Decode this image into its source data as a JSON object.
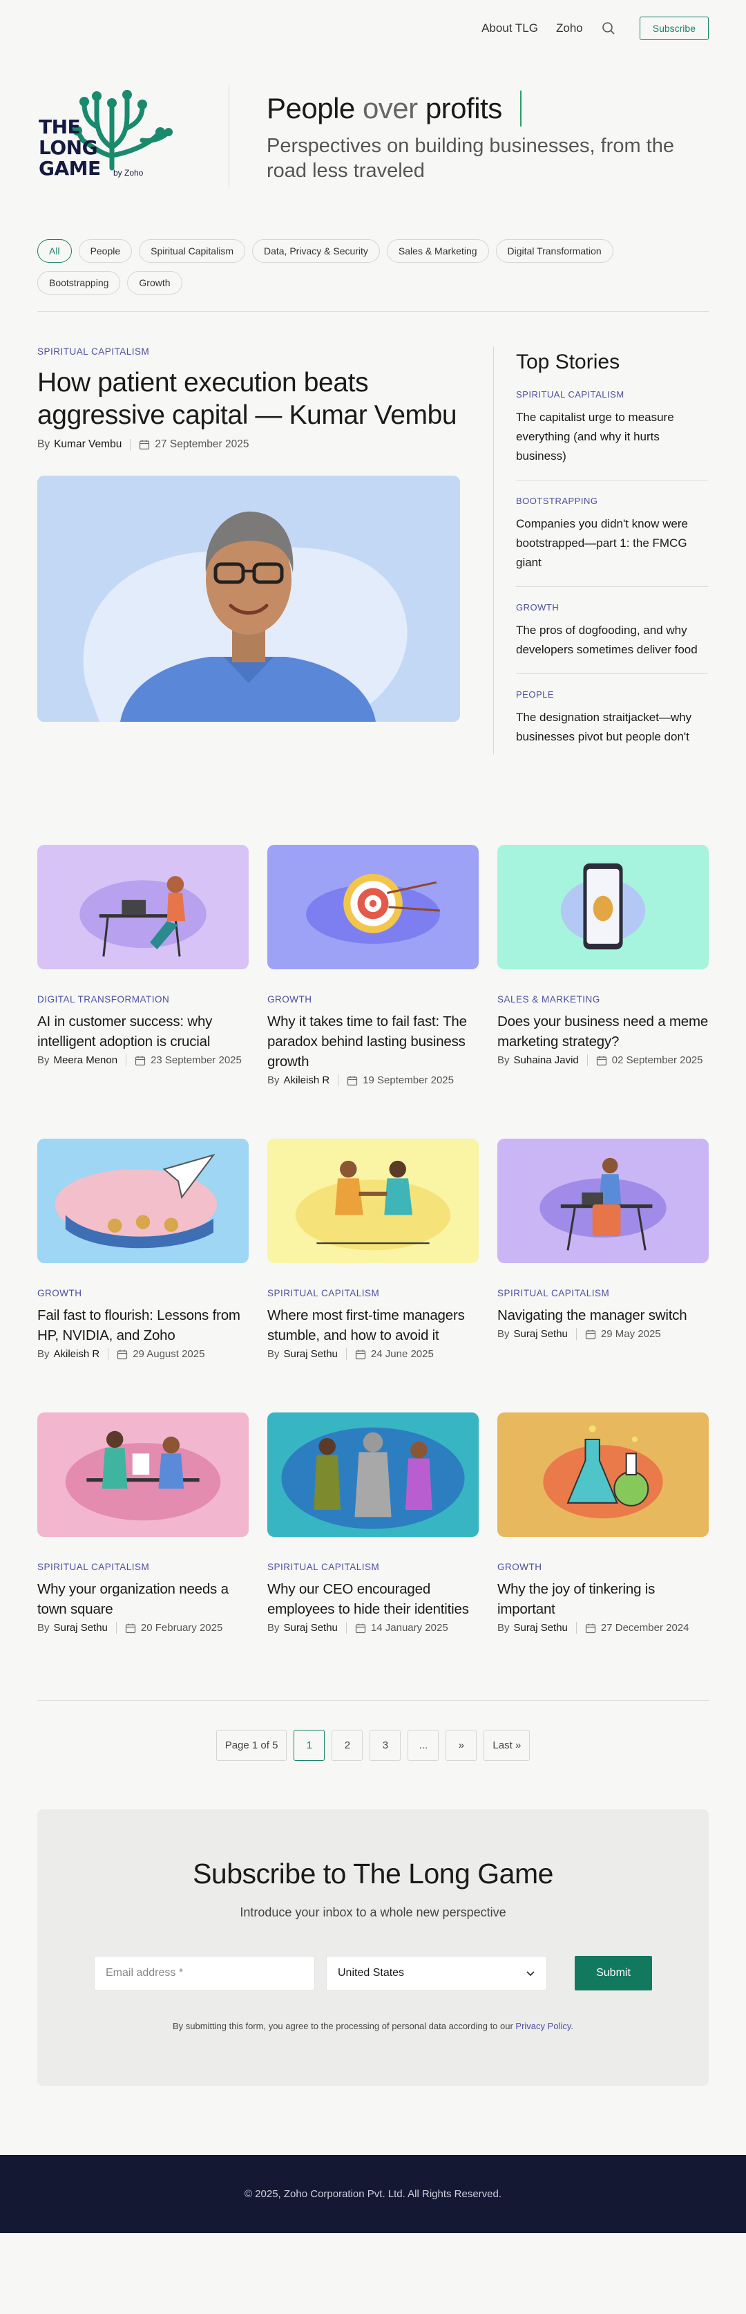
{
  "nav": {
    "about": "About TLG",
    "zoho": "Zoho",
    "search_icon": "search-icon",
    "subscribe": "Subscribe"
  },
  "logo": {
    "line1": "THE",
    "line2": "LONG",
    "line3": "GAME",
    "by": "by Zoho"
  },
  "hero": {
    "title_a": "People",
    "title_b": " over ",
    "title_c": "profits",
    "subtitle": "Perspectives on building businesses, from the road less traveled"
  },
  "filters": [
    "All",
    "People",
    "Spiritual Capitalism",
    "Data, Privacy & Security",
    "Sales & Marketing",
    "Digital Transformation",
    "Bootstrapping",
    "Growth"
  ],
  "featured": {
    "category": "SPIRITUAL CAPITALISM",
    "title": "How patient execution beats aggressive capital — Kumar Vembu",
    "by": "By",
    "author": "Kumar Vembu",
    "date": "27 September 2025"
  },
  "top_stories": {
    "heading": "Top Stories",
    "items": [
      {
        "category": "SPIRITUAL CAPITALISM",
        "title": "The capitalist urge to measure everything (and why it hurts business)"
      },
      {
        "category": "BOOTSTRAPPING",
        "title": "Companies you didn't know were bootstrapped—part 1: the FMCG giant"
      },
      {
        "category": "GROWTH",
        "title": "The pros of dogfooding, and why developers sometimes deliver food"
      },
      {
        "category": "PEOPLE",
        "title": "The designation straitjacket—why businesses pivot but people don't"
      }
    ]
  },
  "articles": [
    {
      "category": "DIGITAL TRANSFORMATION",
      "title": "AI in customer success: why intelligent adoption is crucial",
      "by": "By",
      "author": "Meera Menon",
      "date": "23 September 2025"
    },
    {
      "category": "GROWTH",
      "title": "Why it takes time to fail fast: The paradox behind lasting business growth",
      "by": "By",
      "author": "Akileish R",
      "date": "19 September 2025"
    },
    {
      "category": "SALES & MARKETING",
      "title": "Does your business need a meme marketing strategy?",
      "by": "By",
      "author": "Suhaina Javid",
      "date": "02 September 2025"
    },
    {
      "category": "GROWTH",
      "title": "Fail fast to flourish: Lessons from HP, NVIDIA, and Zoho",
      "by": "By",
      "author": "Akileish R",
      "date": "29 August 2025"
    },
    {
      "category": "SPIRITUAL CAPITALISM",
      "title": "Where most first-time managers stumble, and how to avoid it",
      "by": "By",
      "author": "Suraj Sethu",
      "date": "24 June 2025"
    },
    {
      "category": "SPIRITUAL CAPITALISM",
      "title": "Navigating the manager switch",
      "by": "By",
      "author": "Suraj Sethu",
      "date": "29 May 2025"
    },
    {
      "category": "SPIRITUAL CAPITALISM",
      "title": "Why your organization needs a town square",
      "by": "By",
      "author": "Suraj Sethu",
      "date": "20 February 2025"
    },
    {
      "category": "SPIRITUAL CAPITALISM",
      "title": "Why our CEO encouraged employees to hide their identities",
      "by": "By",
      "author": "Suraj Sethu",
      "date": "14 January 2025"
    },
    {
      "category": "GROWTH",
      "title": "Why the joy of tinkering is important",
      "by": "By",
      "author": "Suraj Sethu",
      "date": "27 December 2024"
    }
  ],
  "pagination": {
    "label": "Page 1 of 5",
    "pages": [
      "1",
      "2",
      "3",
      "..."
    ],
    "next": "»",
    "last": "Last »"
  },
  "subscribe": {
    "title": "Subscribe to The Long Game",
    "intro": "Introduce your inbox to a whole new perspective",
    "email_placeholder": "Email address *",
    "country": "United States",
    "submit": "Submit",
    "consent": "By submitting this form, you agree to the processing of personal data according to our ",
    "policy": "Privacy Policy",
    "period": "."
  },
  "footer": {
    "copyright": "© 2025, Zoho Corporation Pvt. Ltd. All Rights Reserved."
  },
  "colors": {
    "accent_green": "#17806a",
    "category_purple": "#4c4fa2",
    "footer_navy": "#141833"
  }
}
